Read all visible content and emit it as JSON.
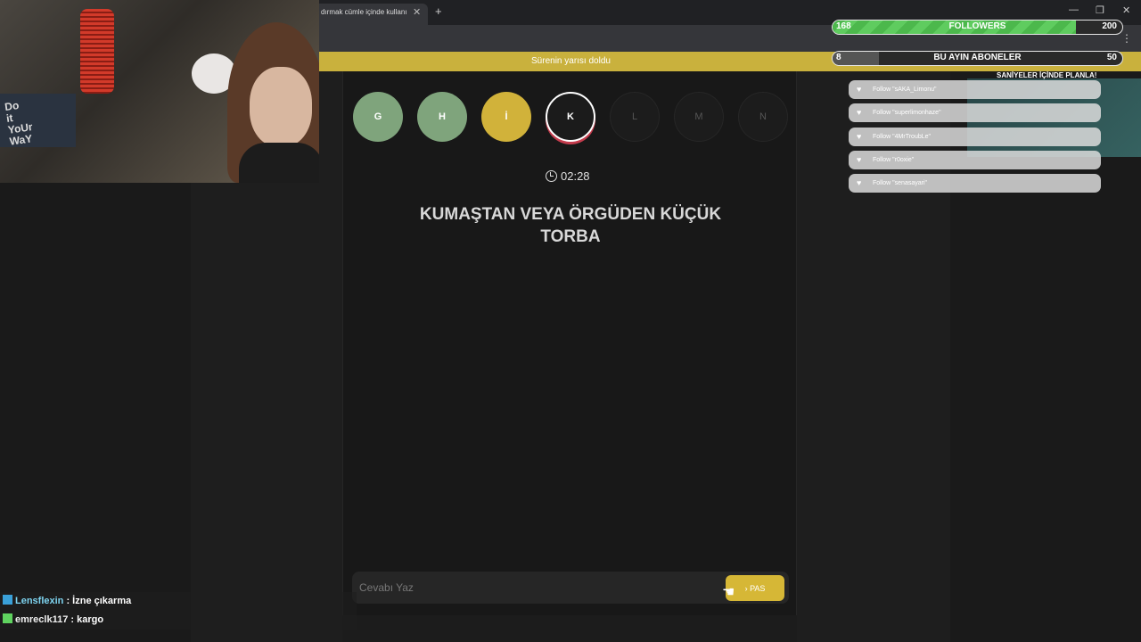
{
  "browser": {
    "tab_title": "dırmak cümle içinde kullanı",
    "tab_close": "✕",
    "new_tab": "+"
  },
  "announcement": "Sürenin yarısı doldu",
  "game": {
    "letters": [
      {
        "letter": "G",
        "state": "done"
      },
      {
        "letter": "H",
        "state": "done"
      },
      {
        "letter": "İ",
        "state": "pass"
      },
      {
        "letter": "K",
        "state": "active"
      },
      {
        "letter": "L",
        "state": "empty"
      },
      {
        "letter": "M",
        "state": "empty"
      },
      {
        "letter": "N",
        "state": "empty"
      }
    ],
    "timer": "02:28",
    "question": "KUMAŞTAN VEYA ÖRGÜDEN KÜÇÜK TORBA",
    "answer_placeholder": "Cevabı Yaz",
    "pass_label": "PAS",
    "pass_icon": "chevron-right-icon"
  },
  "overlay": {
    "followers": {
      "current": "168",
      "label": "FOLLOWERS",
      "goal": "200",
      "fraction": 0.84
    },
    "subs": {
      "current": "8",
      "label": "BU AYIN ABONELER",
      "goal": "50",
      "fraction": 0.16
    },
    "alert_heading": "SANİYELER İÇİNDE PLANLA!",
    "follows": [
      "Follow \"sAKA_Limonu\"",
      "Follow \"superlimonhaze\"",
      "Follow \"4MrTroubLe\"",
      "Follow \"r0oxie\"",
      "Follow \"senasayari\""
    ]
  },
  "chat": [
    {
      "user": "Lensflexin",
      "message": " : İzne çıkarma",
      "badge_color": "#3aa0d8"
    },
    {
      "user": "emreclk117",
      "message": " : kargo",
      "badge_color": "#5fd35f"
    }
  ],
  "colors": {
    "done": "#7fa47c",
    "pass": "#d1b23a",
    "accent": "#c9b13d",
    "progress": "#4cb84c"
  }
}
